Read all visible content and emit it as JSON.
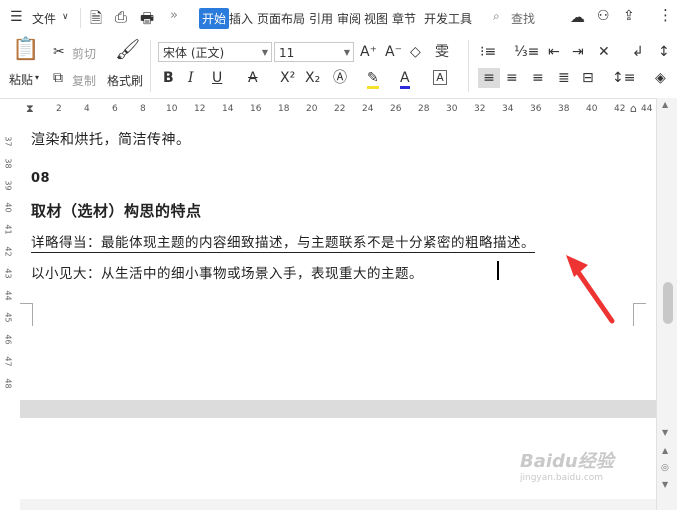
{
  "menubar": {
    "file_label": "文件",
    "tabs": [
      "开始",
      "插入",
      "页面布局",
      "引用",
      "审阅",
      "视图",
      "章节",
      "开发工具"
    ],
    "search_label": "查找"
  },
  "ribbon": {
    "paste_label": "粘贴",
    "cut_label": "剪切",
    "copy_label": "复制",
    "format_painter_label": "格式刷",
    "font_name": "宋体 (正文)",
    "font_size": "11",
    "accent_color": "#2b7bdc"
  },
  "ruler": {
    "numbers": [
      "2",
      "4",
      "6",
      "8",
      "10",
      "12",
      "14",
      "16",
      "18",
      "20",
      "22",
      "24",
      "26",
      "28",
      "30",
      "32",
      "34",
      "36",
      "38",
      "40",
      "42",
      "44"
    ],
    "vertical_numbers": [
      "37",
      "38",
      "39",
      "40",
      "41",
      "42",
      "43",
      "44",
      "45",
      "46",
      "47",
      "48"
    ]
  },
  "document": {
    "line1": "渲染和烘托，简洁传神。",
    "heading_num": "08",
    "heading": "取材（选材）构思的特点",
    "line_underlined": "详略得当：最能体现主题的内容细致描述，与主题联系不是十分紧密的粗略描述。",
    "line_last": "以小见大：从生活中的细小事物或场景入手，表现重大的主题。"
  },
  "watermark": {
    "brand": "Baidu经验",
    "url": "jingyan.baidu.com"
  }
}
